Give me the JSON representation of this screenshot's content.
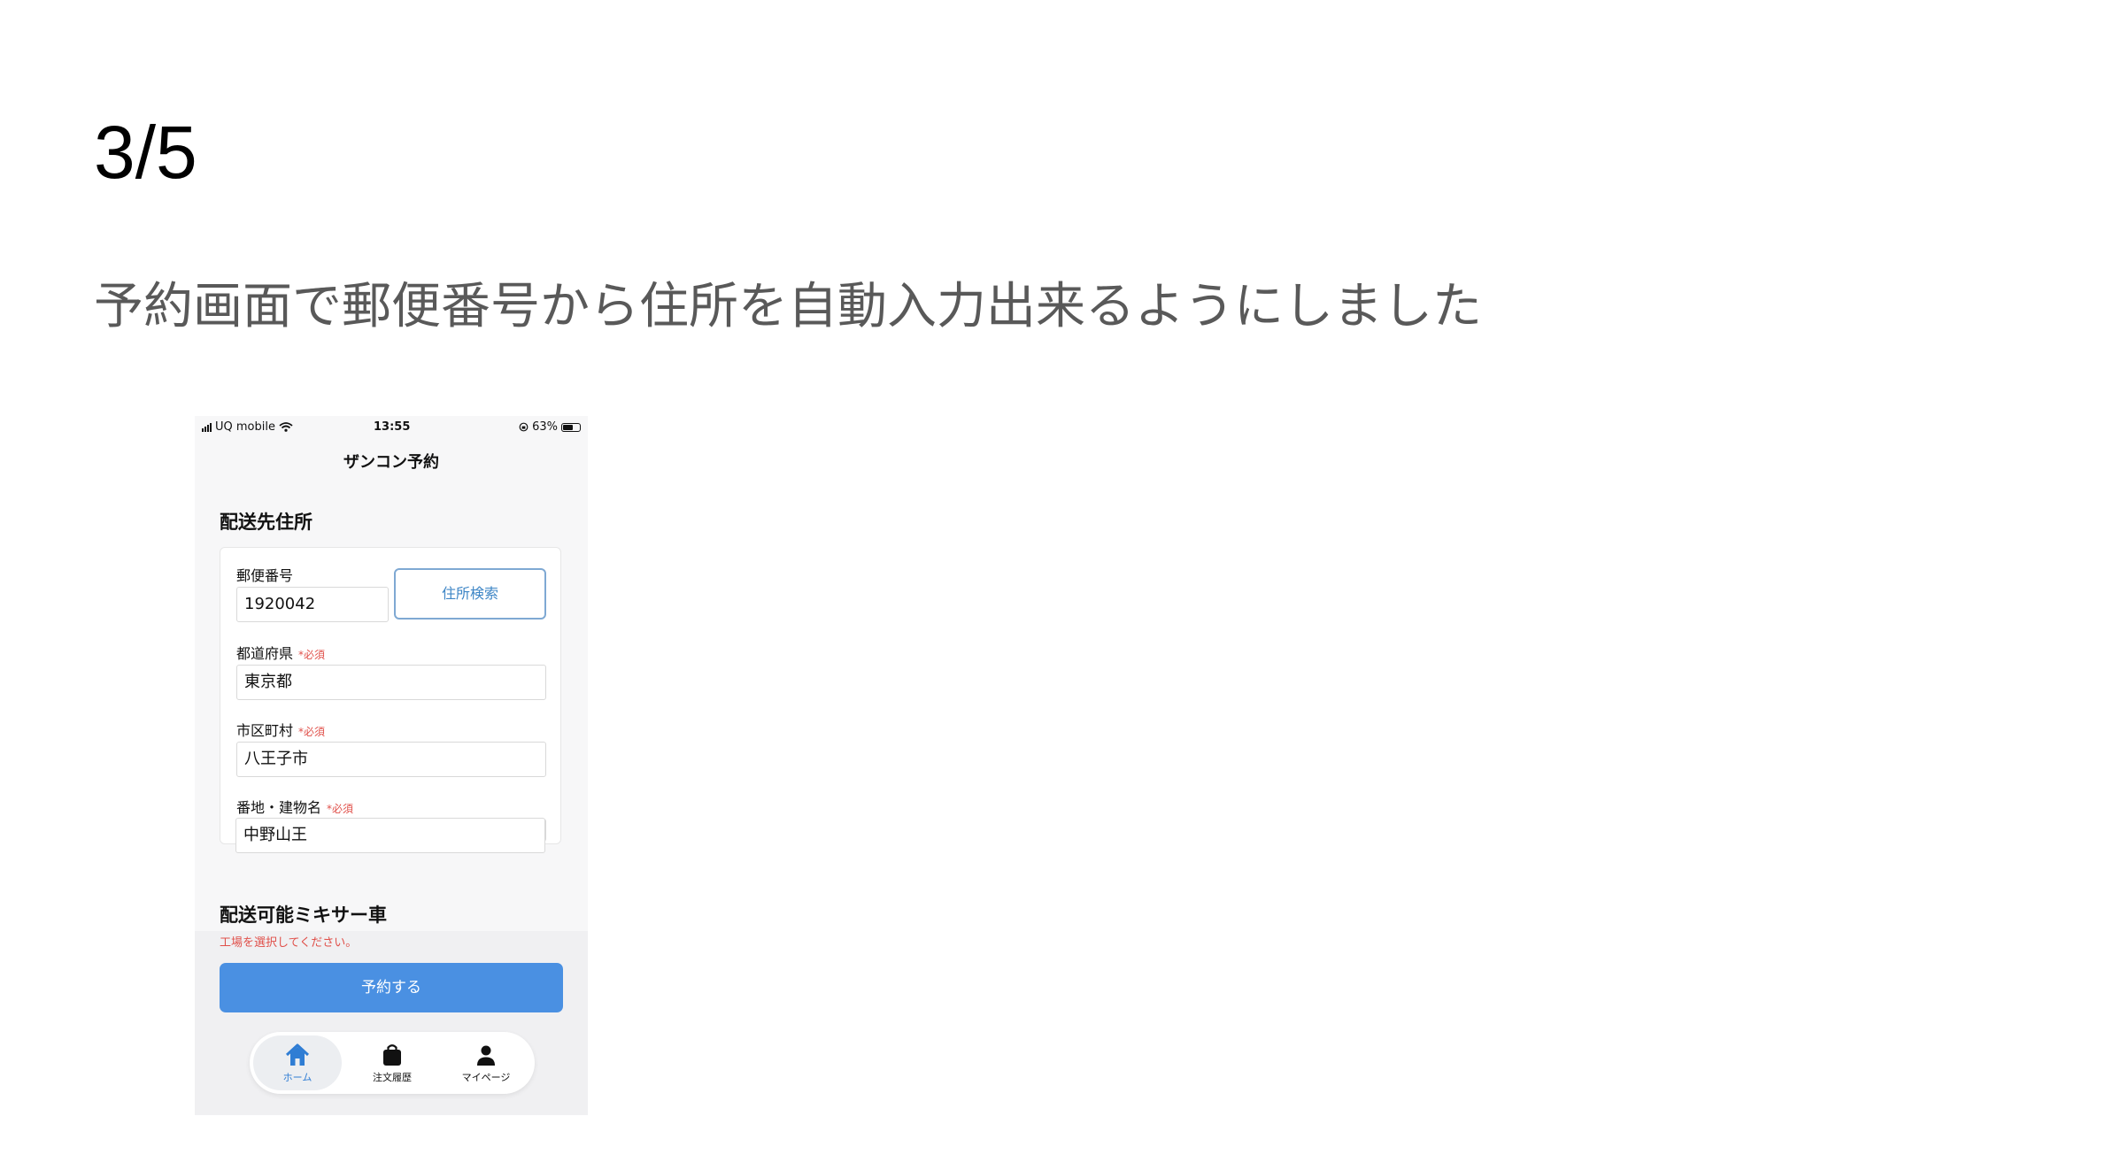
{
  "slide": {
    "counter": "3/5",
    "caption": "予約画面で郵便番号から住所を自動入力出来るようにしました"
  },
  "phone": {
    "status_bar": {
      "carrier": "UQ mobile",
      "time": "13:55",
      "battery": "63%",
      "battery_level": 0.63
    },
    "nav_title": "ザンコン予約",
    "address_section": {
      "title": "配送先住所",
      "postal": {
        "label": "郵便番号",
        "value": "1920042"
      },
      "search_button": "住所検索",
      "prefecture": {
        "label": "都道府県",
        "required": "*必須",
        "value": "東京都"
      },
      "city": {
        "label": "市区町村",
        "required": "*必須",
        "value": "八王子市"
      },
      "street": {
        "label": "番地・建物名",
        "required": "*必須",
        "value": "中野山王"
      }
    },
    "mixer_section": {
      "title": "配送可能ミキサー車"
    },
    "error_message": "工場を選択してください。",
    "reserve_button": "予約する",
    "tabs": [
      {
        "label": "ホーム",
        "icon": "home-icon",
        "active": true
      },
      {
        "label": "注文履歴",
        "icon": "bag-icon",
        "active": false
      },
      {
        "label": "マイページ",
        "icon": "person-icon",
        "active": false
      }
    ],
    "colors": {
      "accent": "#4a90e2",
      "error": "#e0504a",
      "active_tab": "#2f7dd4"
    }
  }
}
